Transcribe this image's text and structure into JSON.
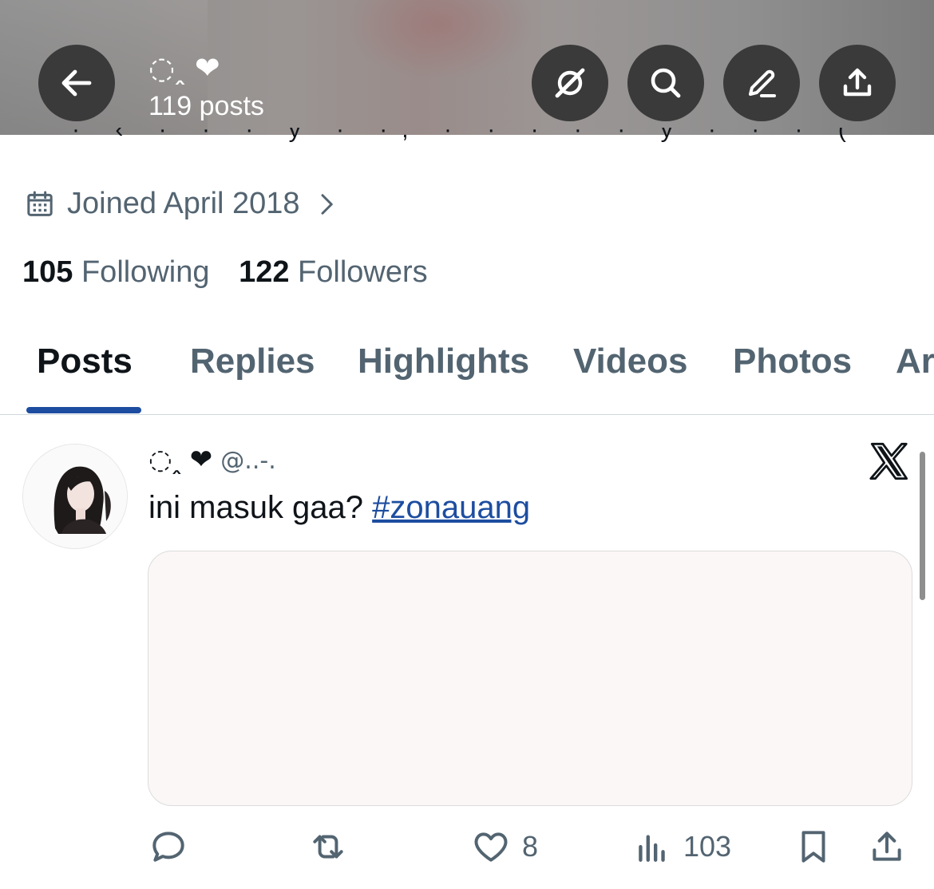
{
  "header": {
    "display_name": "◌ꞈ ❤",
    "posts_count": "119 posts",
    "buttons": {
      "back": "arrow-left-icon",
      "grok": "grok-icon",
      "search": "search-icon",
      "edit": "edit-icon",
      "share": "share-icon"
    }
  },
  "profile": {
    "joined": "Joined April 2018",
    "following_count": "105",
    "following_label": "Following",
    "followers_count": "122",
    "followers_label": "Followers"
  },
  "tabs": [
    {
      "label": "Posts",
      "active": true
    },
    {
      "label": "Replies"
    },
    {
      "label": "Highlights"
    },
    {
      "label": "Videos"
    },
    {
      "label": "Photos"
    },
    {
      "label": "Ar"
    }
  ],
  "post": {
    "author_name": "◌ꞈ ❤",
    "handle": "@..-.",
    "text": "ini masuk gaa? ",
    "hashtag": "#zonauang",
    "actions": {
      "reply_count": "",
      "repost_count": "",
      "like_count": "8",
      "views_count": "103"
    }
  },
  "colors": {
    "accent": "#1d4da0",
    "secondary_text": "#536471",
    "primary_text": "#0f1419",
    "header_button_bg": "#3a3a3a"
  }
}
